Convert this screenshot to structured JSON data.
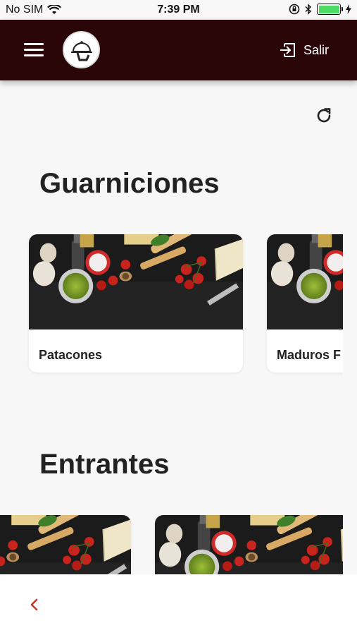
{
  "status_bar": {
    "carrier": "No SIM",
    "time": "7:39 PM",
    "battery_color": "#4cd964"
  },
  "header": {
    "background": "#2a0608",
    "menu_icon": "hamburger-menu-icon",
    "logo_icon": "serving-cloche-icon",
    "exit_label": "Salir",
    "exit_icon": "exit-icon"
  },
  "toolbar": {
    "refresh_icon": "refresh-icon"
  },
  "sections": [
    {
      "title": "Guarniciones",
      "items": [
        {
          "name": "Patacones"
        },
        {
          "name": "Maduros F"
        }
      ]
    },
    {
      "title": "Entrantes",
      "items": [
        {
          "name": ""
        },
        {
          "name": ""
        }
      ]
    }
  ],
  "bottom_bar": {
    "back_icon": "chevron-left-icon",
    "accent": "#c0392b"
  }
}
